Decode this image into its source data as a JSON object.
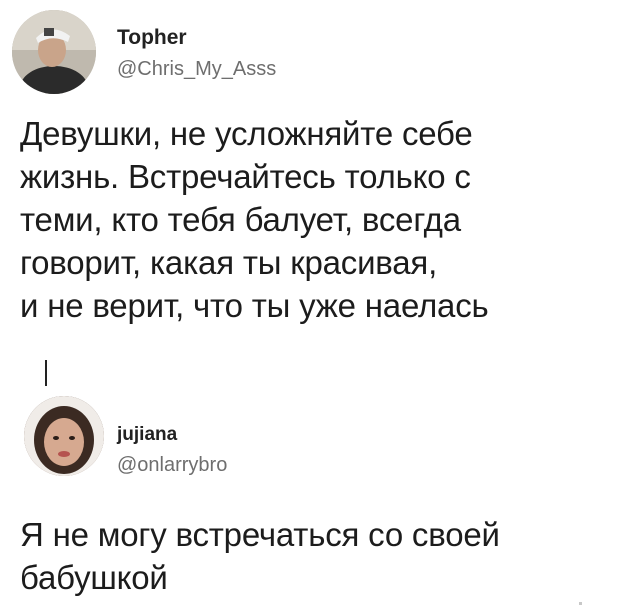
{
  "tweets": [
    {
      "author": {
        "name": "Topher",
        "handle": "@Chris_My_Asss",
        "avatar_icon": "user-avatar-photo"
      },
      "text": "Девушки, не усложняйте себе\nжизнь. Встречайтесь только с\nтеми, кто тебя балует, всегда\nговорит, какая ты красивая,\nи не верит, что ты уже наелась"
    },
    {
      "author": {
        "name": "jujiana",
        "handle": "@onlarrybro",
        "avatar_icon": "user-avatar-photo"
      },
      "text": "Я не могу встречаться со своей\nбабушкой"
    }
  ],
  "colors": {
    "background": "#ffffff",
    "text": "#1c1c1c",
    "handle": "#6e6e6e"
  }
}
